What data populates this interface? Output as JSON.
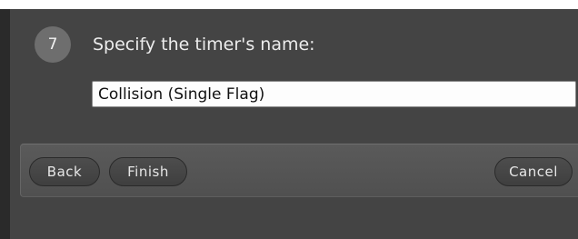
{
  "wizard": {
    "step_number": "7",
    "prompt": "Specify the timer's name:",
    "timer_name": "Collision (Single Flag)"
  },
  "buttons": {
    "back": "Back",
    "finish": "Finish",
    "cancel": "Cancel"
  },
  "colors": {
    "dialog_background": "#444444",
    "badge": "#6e6e6e",
    "field_background": "#fdfdfd"
  }
}
